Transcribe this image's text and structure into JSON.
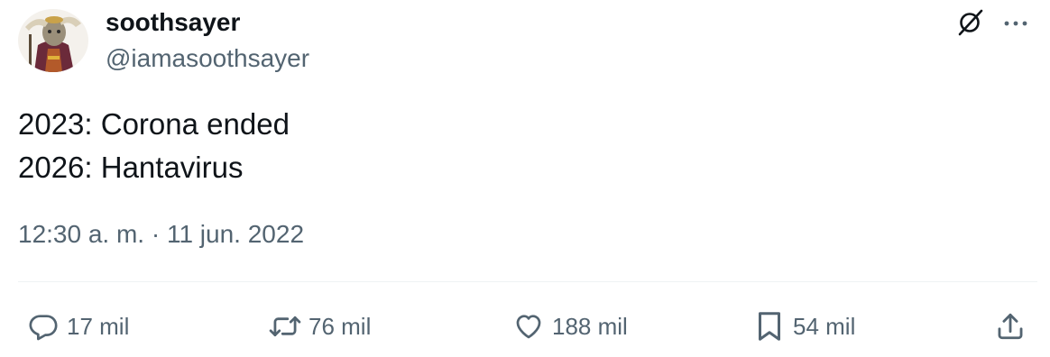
{
  "author": {
    "display_name": "soothsayer",
    "handle": "@iamasoothsayer"
  },
  "post": {
    "lines": [
      "2023: Corona ended",
      "2026: Hantavirus"
    ],
    "timestamp": "12:30 a. m. · 11 jun. 2022"
  },
  "actions": {
    "replies": "17 mil",
    "reposts": "76 mil",
    "likes": "188 mil",
    "bookmarks": "54 mil"
  },
  "icons": {
    "top": [
      "grok-icon",
      "more-icon"
    ],
    "actions": [
      "reply-icon",
      "repost-icon",
      "like-icon",
      "bookmark-icon",
      "share-icon"
    ]
  },
  "colors": {
    "text_primary": "#0f1419",
    "text_secondary": "#536471",
    "divider": "#eff3f4"
  }
}
